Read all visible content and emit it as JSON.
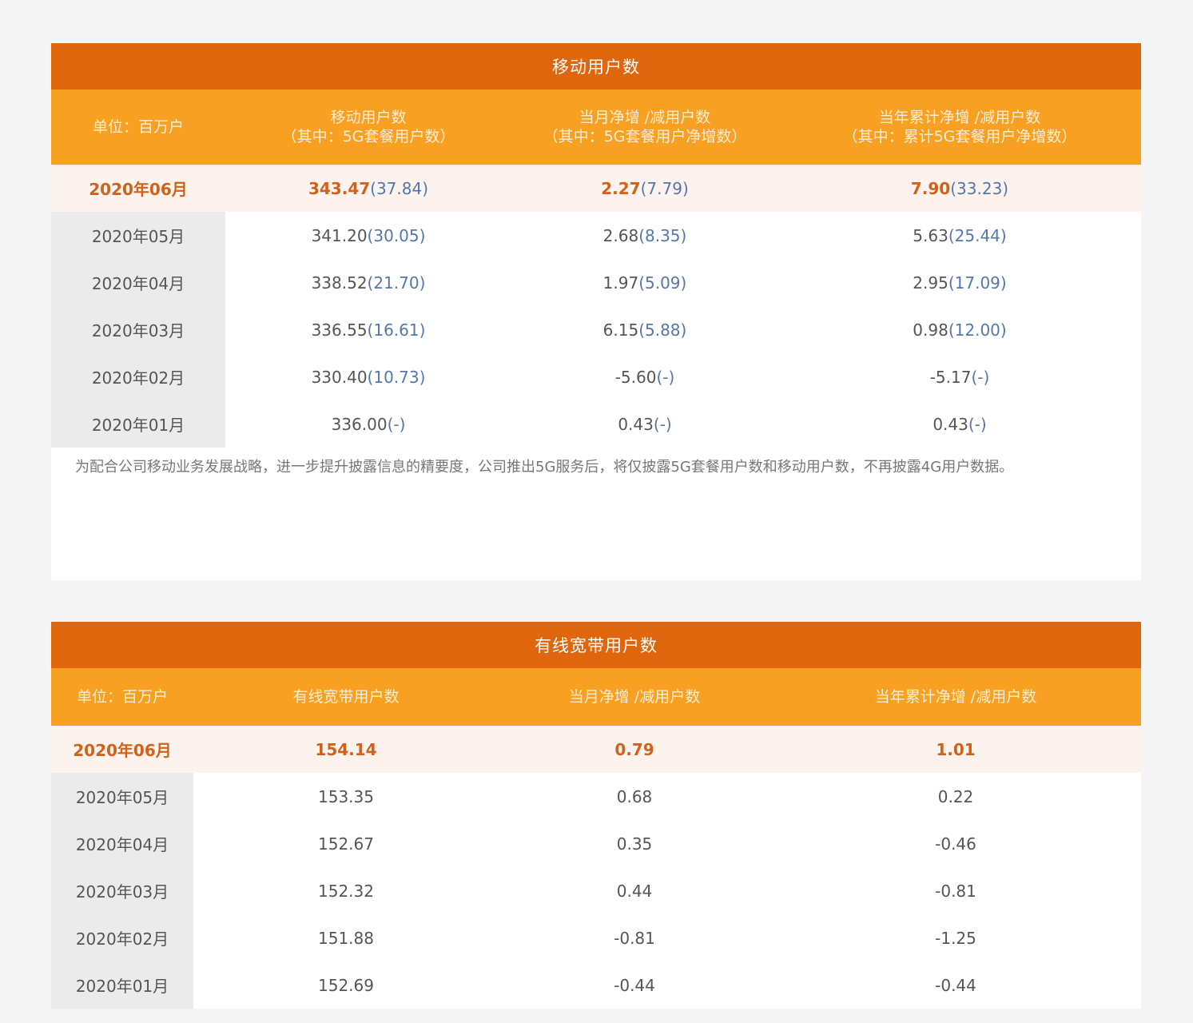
{
  "mobile": {
    "title": "移动用户数",
    "headers": [
      {
        "line1": "单位：百万户",
        "line2": ""
      },
      {
        "line1": "移动用户数",
        "line2": "（其中：5G套餐用户数）"
      },
      {
        "line1": "当月净增 /减用户数",
        "line2": "（其中：5G套餐用户净增数）"
      },
      {
        "line1": "当年累计净增 /减用户数",
        "line2": "（其中：累计5G套餐用户净增数）"
      }
    ],
    "rows": [
      {
        "date": "2020年06月",
        "c1": "343.47",
        "c1b": "(37.84)",
        "c2": "2.27",
        "c2b": "(7.79)",
        "c3": "7.90",
        "c3b": "(33.23)"
      },
      {
        "date": "2020年05月",
        "c1": "341.20",
        "c1b": "(30.05)",
        "c2": "2.68",
        "c2b": "(8.35)",
        "c3": "5.63",
        "c3b": "(25.44)"
      },
      {
        "date": "2020年04月",
        "c1": "338.52",
        "c1b": "(21.70)",
        "c2": "1.97",
        "c2b": "(5.09)",
        "c3": "2.95",
        "c3b": "(17.09)"
      },
      {
        "date": "2020年03月",
        "c1": "336.55",
        "c1b": "(16.61)",
        "c2": "6.15",
        "c2b": "(5.88)",
        "c3": "0.98",
        "c3b": "(12.00)"
      },
      {
        "date": "2020年02月",
        "c1": "330.40",
        "c1b": "(10.73)",
        "c2": "-5.60",
        "c2b": "(-)",
        "c3": "-5.17",
        "c3b": "(-)"
      },
      {
        "date": "2020年01月",
        "c1": "336.00",
        "c1b": "(-)",
        "c2": "0.43",
        "c2b": "(-)",
        "c3": "0.43",
        "c3b": "(-)"
      }
    ],
    "note": "为配合公司移动业务发展战略，进一步提升披露信息的精要度，公司推出5G服务后，将仅披露5G套餐用户数和移动用户数，不再披露4G用户数据。"
  },
  "broadband": {
    "title": "有线宽带用户数",
    "headers": [
      "单位：百万户",
      "有线宽带用户数",
      "当月净增 /减用户数",
      "当年累计净增 /减用户数"
    ],
    "rows": [
      {
        "date": "2020年06月",
        "c1": "154.14",
        "c2": "0.79",
        "c3": "1.01"
      },
      {
        "date": "2020年05月",
        "c1": "153.35",
        "c2": "0.68",
        "c3": "0.22"
      },
      {
        "date": "2020年04月",
        "c1": "152.67",
        "c2": "0.35",
        "c3": "-0.46"
      },
      {
        "date": "2020年03月",
        "c1": "152.32",
        "c2": "0.44",
        "c3": "-0.81"
      },
      {
        "date": "2020年02月",
        "c1": "151.88",
        "c2": "-0.81",
        "c3": "-1.25"
      },
      {
        "date": "2020年01月",
        "c1": "152.69",
        "c2": "-0.44",
        "c3": "-0.44"
      }
    ]
  }
}
